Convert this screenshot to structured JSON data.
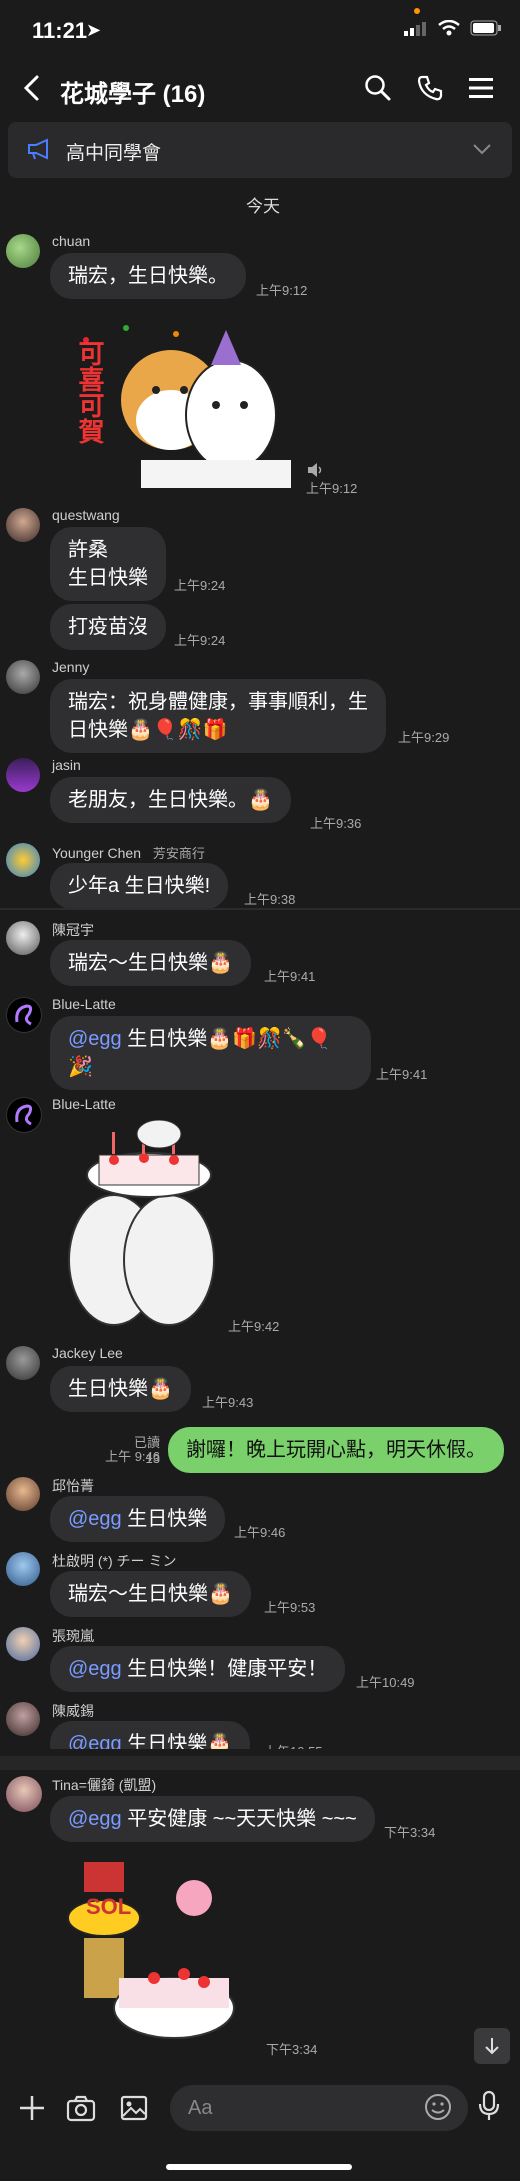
{
  "status": {
    "time": "11:21"
  },
  "header": {
    "title": "花城學子 (16)"
  },
  "notice": {
    "text": "高中同學會"
  },
  "date": "今天",
  "msgs": {
    "m1": {
      "sender": "chuan",
      "text": "瑞宏，生日快樂。",
      "time": "上午9:12"
    },
    "m2": {
      "time": "上午9:12"
    },
    "m3": {
      "sender": "questwang",
      "text1": "許桑",
      "text2": "生日快樂",
      "time": "上午9:24"
    },
    "m4": {
      "text": "打疫苗沒",
      "time": "上午9:24"
    },
    "m5": {
      "sender": "Jenny",
      "text1": "瑞宏：祝身體健康，事事順利，生",
      "text2": "日快樂🎂🎈🎊🎁",
      "time": "上午9:29"
    },
    "m6": {
      "sender": "jasin",
      "text": "老朋友，生日快樂。🎂",
      "time": "上午9:36"
    },
    "m7": {
      "sender": "Younger Chen",
      "sender_note": "芳安商行",
      "text": "少年a  生日快樂!",
      "time": "上午9:38"
    },
    "m8": {
      "sender": "陳冠宇",
      "text": "瑞宏～生日快樂🎂",
      "time": "上午9:41"
    },
    "m9": {
      "sender": "Blue-Latte",
      "mention": "@egg",
      "text1": " 生日快樂🎂🎁🎊🍾🎈",
      "text2": "🎉",
      "time": "上午9:41"
    },
    "m10": {
      "sender": "Blue-Latte",
      "time": "上午9:42"
    },
    "m11": {
      "sender": "Jackey Lee",
      "text": "生日快樂🎂",
      "time": "上午9:43"
    },
    "m12": {
      "read": "已讀 13",
      "time": "上午 9:46",
      "text": "謝囉！晚上玩開心點，明天休假。"
    },
    "m13": {
      "sender": "邱怡菁",
      "mention": "@egg",
      "text": " 生日快樂",
      "time": "上午9:46"
    },
    "m14": {
      "sender": "杜啟明 (*) チー ミン",
      "text": "瑞宏～生日快樂🎂",
      "time": "上午9:53"
    },
    "m15": {
      "sender": "張琬嵐",
      "mention": "@egg",
      "text": " 生日快樂！健康平安！",
      "time": "上午10:49"
    },
    "m16": {
      "sender": "陳威錫",
      "mention": "@egg",
      "text": " 生日快樂🎂",
      "time": "上午10:55"
    },
    "m17": {
      "sender": "Tina=儷錡 (凱盟)",
      "mention": "@egg",
      "text": " 平安健康 ~~天天快樂 ~~~",
      "time": "下午3:34"
    },
    "m18": {
      "time": "下午3:34"
    }
  },
  "stickers": {
    "s1_text": "可喜可賀",
    "s3_text": "SOL"
  },
  "input": {
    "placeholder": "Aa"
  },
  "colors": {
    "accent": "#7ad06a",
    "mention": "#7a9bff",
    "bg": "#1b1b1c",
    "bubble": "#2f2f31"
  }
}
